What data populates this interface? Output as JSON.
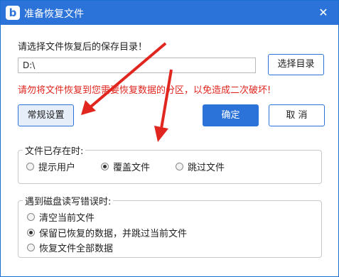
{
  "window": {
    "title": "准备恢复文件",
    "app_icon_letter": "b",
    "close_glyph": "✕",
    "accent_color": "#2b73d8",
    "warning_color": "#e0261f"
  },
  "form": {
    "prompt": "请选择文件恢复后的保存目录！",
    "dir_value": "D:\\",
    "choose_dir_label": "选择目录",
    "warning": "请勿将文件恢复到您需要恢复数据的分区，以免造成二次破坏!"
  },
  "buttons": {
    "general": "常规设置",
    "ok": "确定",
    "cancel": "取 消"
  },
  "file_exists_group": {
    "title": "文件已存在时:",
    "options": [
      "提示用户",
      "覆盖文件",
      "跳过文件"
    ],
    "selected": "覆盖文件"
  },
  "disk_error_group": {
    "title": "遇到磁盘读写错误时:",
    "options": [
      "清空当前文件",
      "保留已恢复的数据，并跳过当前文件",
      "恢复文件全部数据"
    ],
    "selected": "保留已恢复的数据，并跳过当前文件"
  }
}
